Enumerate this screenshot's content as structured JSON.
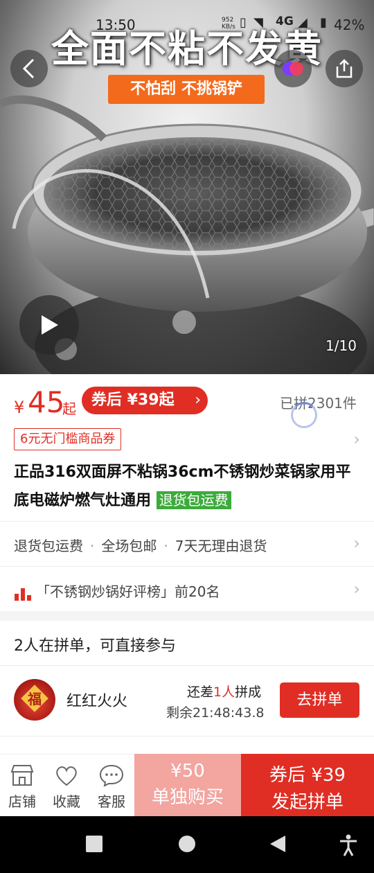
{
  "status_bar": {
    "time": "13:50",
    "net_speed_value": "952",
    "net_speed_unit": "KB/s",
    "network": "4G",
    "battery": "42%"
  },
  "hero": {
    "promo_title": "全面不粘不发黄",
    "promo_subtitle": "不怕刮 不挑锅铲",
    "image_counter": "1/10",
    "icons": {
      "back": "back-arrow-icon",
      "mini_program": "mini-app-icon",
      "share": "share-icon",
      "play": "play-icon"
    }
  },
  "price": {
    "currency": "¥",
    "value": "45",
    "suffix": "起",
    "coupon_label": "券后 ¥39起",
    "sold": "已拼2301件"
  },
  "store_coupon": "6元无门槛商品券",
  "product": {
    "title": "正品316双面屏不粘锅36cm不锈钢炒菜锅家用平底电磁炉燃气灶通用",
    "title_tag": "退货包运费"
  },
  "services": [
    "退货包运费",
    "全场包邮",
    "7天无理由退货"
  ],
  "ranking": "「不锈钢炒锅好评榜」前20名",
  "group": {
    "header": "2人在拼单，可直接参与",
    "items": [
      {
        "avatar_text": "福",
        "name": "红红火火",
        "need_prefix": "还差",
        "need_count": "1人",
        "need_suffix": "拼成",
        "time_left": "剩余21:48:43.8",
        "button": "去拼单"
      }
    ]
  },
  "bottom_bar": {
    "store": "店铺",
    "favorite": "收藏",
    "service": "客服",
    "single_price": "¥50",
    "single_label": "单独购买",
    "group_price": "券后 ¥39",
    "group_label": "发起拼单"
  },
  "colors": {
    "accent": "#e02e24",
    "green_tag": "#3dab3c",
    "promo_orange": "#f36a1c"
  }
}
